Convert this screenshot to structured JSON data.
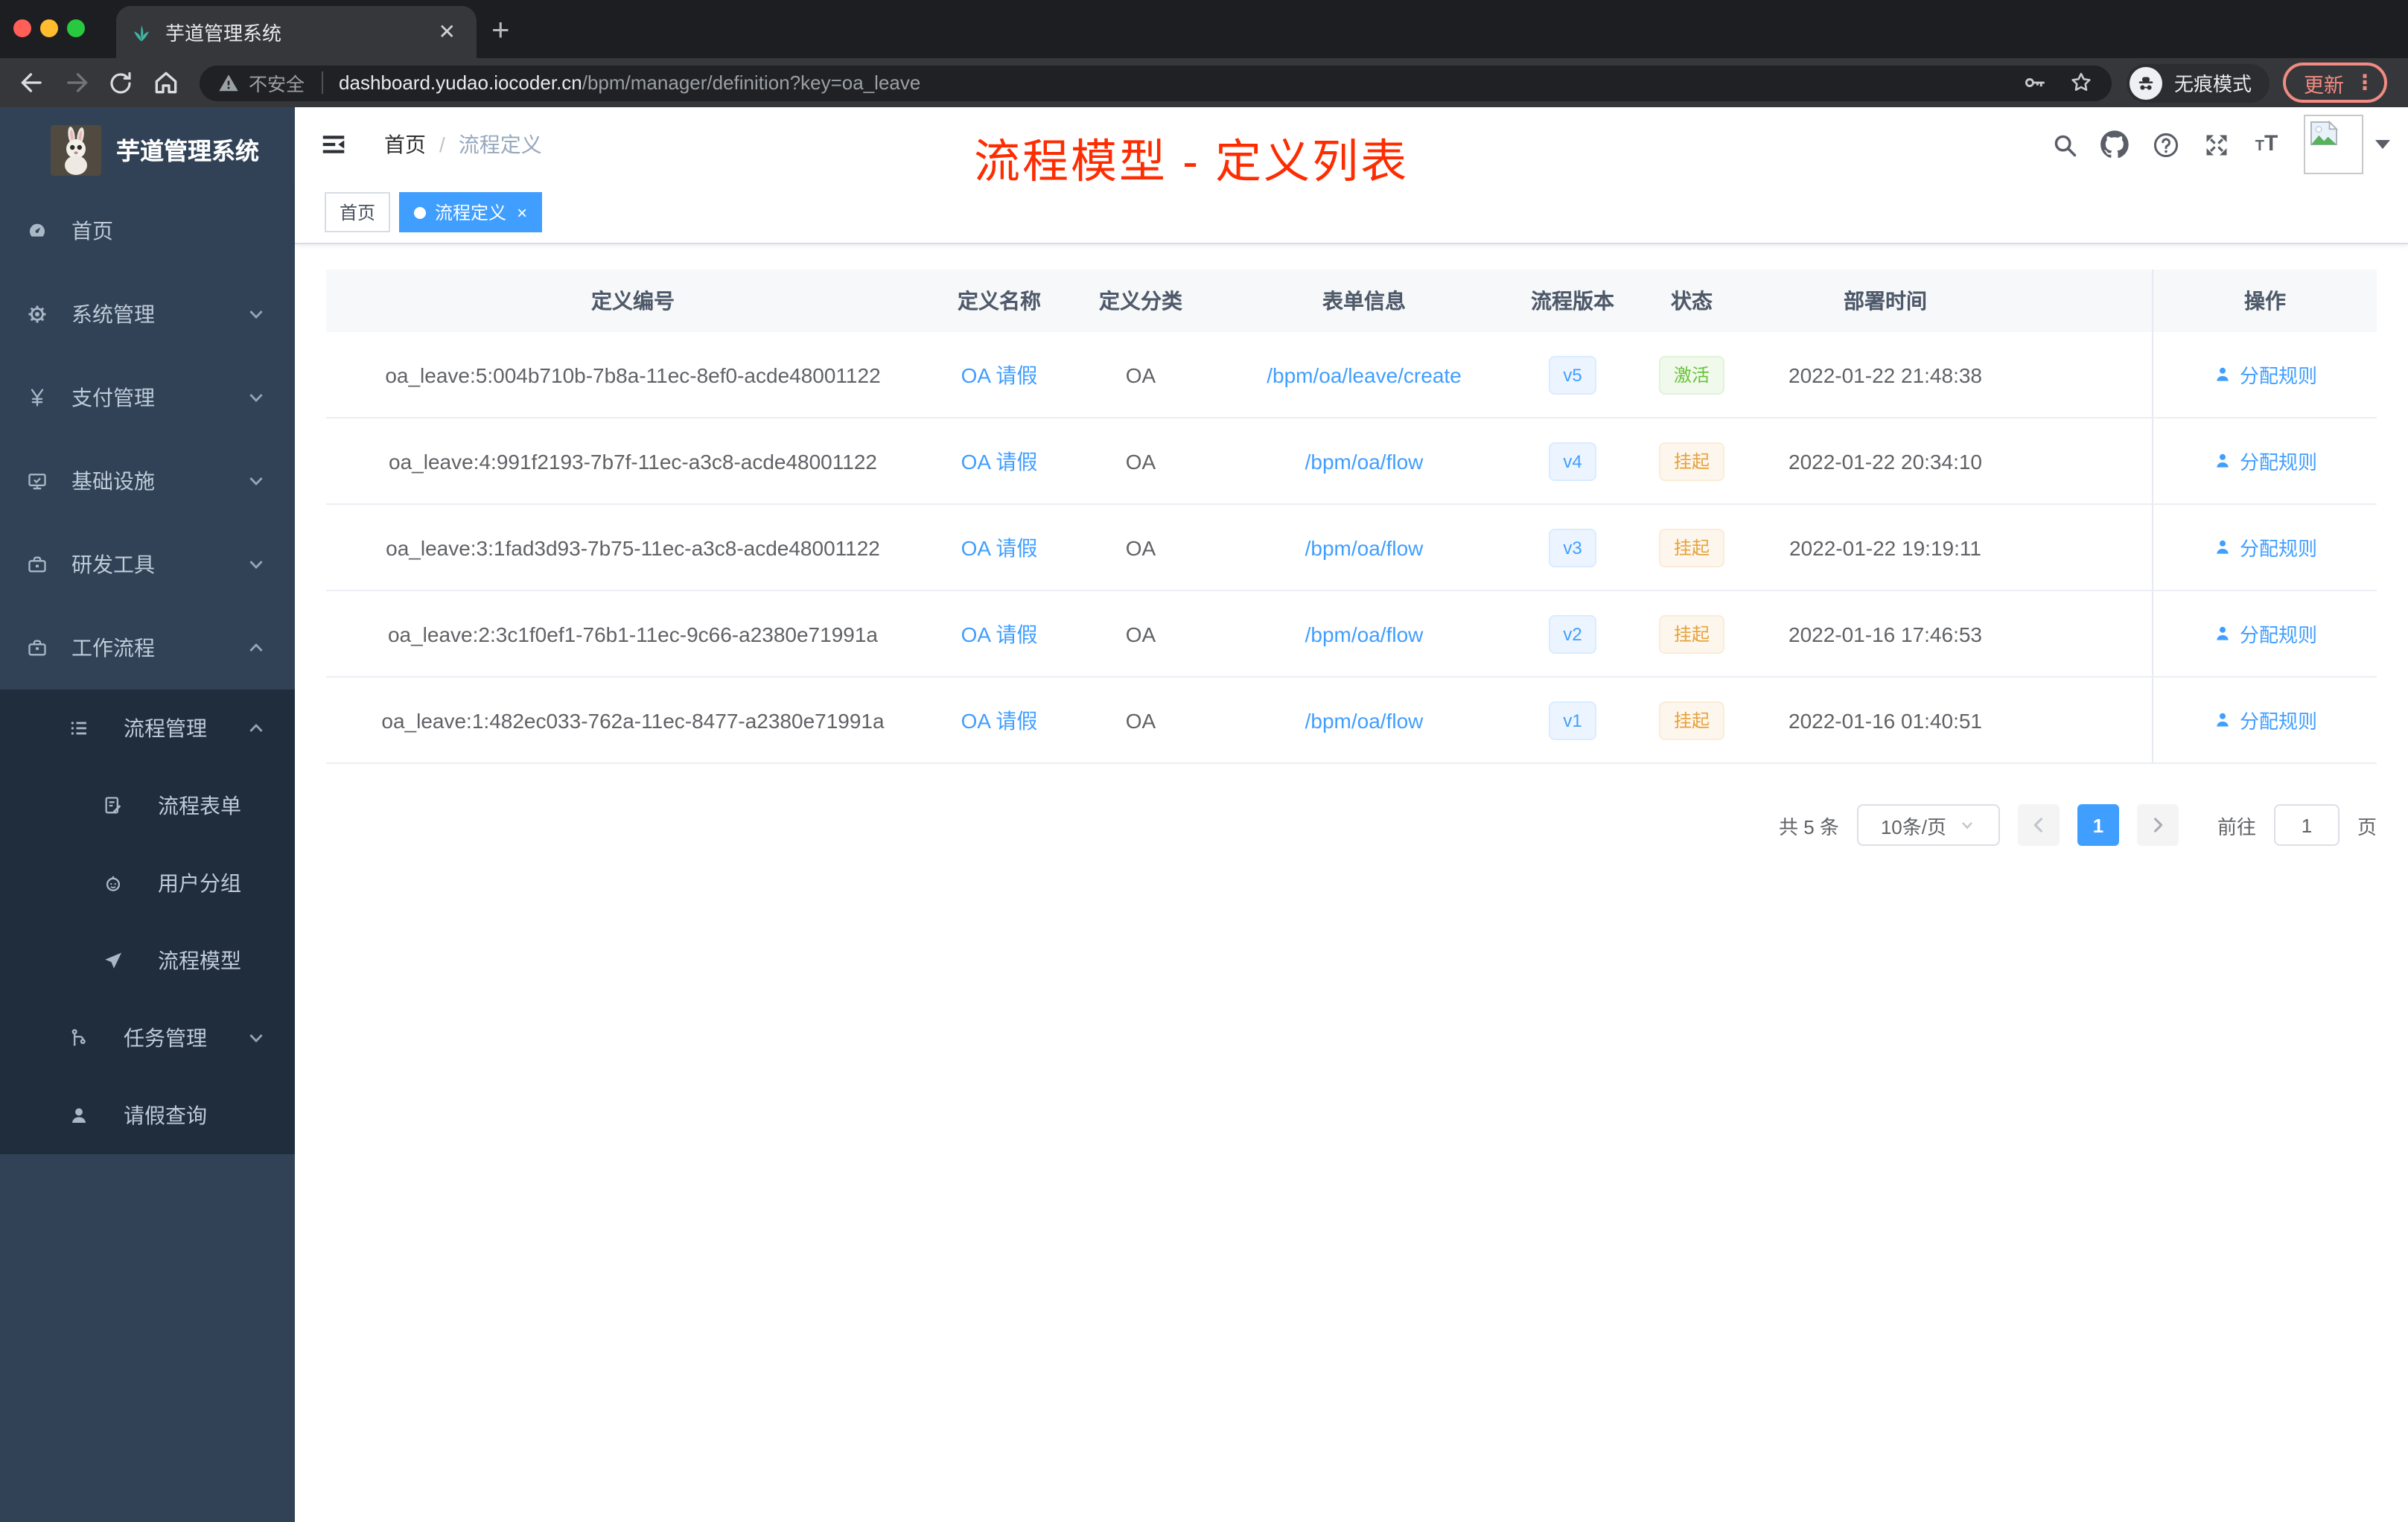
{
  "browser": {
    "tab_title": "芋道管理系统",
    "tab_close": "✕",
    "new_tab": "+",
    "security_label": "不安全",
    "url_host": "dashboard.yudao.iocoder.cn",
    "url_path": "/bpm/manager/definition?key=oa_leave",
    "incognito_label": "无痕模式",
    "update_label": "更新",
    "menu_dots": "⋮"
  },
  "sidebar": {
    "logo_title": "芋道管理系统",
    "items": [
      {
        "label": "首页",
        "icon": "dashboard-icon",
        "level": 1,
        "dark": false,
        "chevron": ""
      },
      {
        "label": "系统管理",
        "icon": "gear-icon",
        "level": 1,
        "dark": false,
        "chevron": "down"
      },
      {
        "label": "支付管理",
        "icon": "yen-icon",
        "level": 1,
        "dark": false,
        "chevron": "down"
      },
      {
        "label": "基础设施",
        "icon": "monitor-icon",
        "level": 1,
        "dark": false,
        "chevron": "down"
      },
      {
        "label": "研发工具",
        "icon": "toolbox-icon",
        "level": 1,
        "dark": false,
        "chevron": "down"
      },
      {
        "label": "工作流程",
        "icon": "briefcase-icon",
        "level": 1,
        "dark": false,
        "chevron": "up"
      },
      {
        "label": "流程管理",
        "icon": "list-icon",
        "level": 2,
        "dark": true,
        "chevron": "up"
      },
      {
        "label": "流程表单",
        "icon": "form-icon",
        "level": 3,
        "dark": true,
        "chevron": ""
      },
      {
        "label": "用户分组",
        "icon": "robot-icon",
        "level": 3,
        "dark": true,
        "chevron": ""
      },
      {
        "label": "流程模型",
        "icon": "paper-plane-icon",
        "level": 3,
        "dark": true,
        "chevron": ""
      },
      {
        "label": "任务管理",
        "icon": "flow-icon",
        "level": 2,
        "dark": true,
        "chevron": "down"
      },
      {
        "label": "请假查询",
        "icon": "user-icon",
        "level": 2,
        "dark": true,
        "chevron": ""
      }
    ]
  },
  "header": {
    "breadcrumb": [
      "首页",
      "流程定义"
    ],
    "breadcrumb_separator": "/",
    "annotation": "流程模型 - 定义列表",
    "annotation_color": "#fe2c01"
  },
  "tags": [
    {
      "label": "首页",
      "active": false
    },
    {
      "label": "流程定义",
      "active": true,
      "close": "×"
    }
  ],
  "table": {
    "columns": [
      "定义编号",
      "定义名称",
      "定义分类",
      "表单信息",
      "流程版本",
      "状态",
      "部署时间",
      "操作"
    ],
    "rows": [
      {
        "id": "oa_leave:5:004b710b-7b8a-11ec-8ef0-acde48001122",
        "name": "OA 请假",
        "category": "OA",
        "form": "/bpm/oa/leave/create",
        "version": "v5",
        "status": "激活",
        "status_type": "success",
        "deployed": "2022-01-22 21:48:38",
        "action": "分配规则"
      },
      {
        "id": "oa_leave:4:991f2193-7b7f-11ec-a3c8-acde48001122",
        "name": "OA 请假",
        "category": "OA",
        "form": "/bpm/oa/flow",
        "version": "v4",
        "status": "挂起",
        "status_type": "warning",
        "deployed": "2022-01-22 20:34:10",
        "action": "分配规则"
      },
      {
        "id": "oa_leave:3:1fad3d93-7b75-11ec-a3c8-acde48001122",
        "name": "OA 请假",
        "category": "OA",
        "form": "/bpm/oa/flow",
        "version": "v3",
        "status": "挂起",
        "status_type": "warning",
        "deployed": "2022-01-22 19:19:11",
        "action": "分配规则"
      },
      {
        "id": "oa_leave:2:3c1f0ef1-76b1-11ec-9c66-a2380e71991a",
        "name": "OA 请假",
        "category": "OA",
        "form": "/bpm/oa/flow",
        "version": "v2",
        "status": "挂起",
        "status_type": "warning",
        "deployed": "2022-01-16 17:46:53",
        "action": "分配规则"
      },
      {
        "id": "oa_leave:1:482ec033-762a-11ec-8477-a2380e71991a",
        "name": "OA 请假",
        "category": "OA",
        "form": "/bpm/oa/flow",
        "version": "v1",
        "status": "挂起",
        "status_type": "warning",
        "deployed": "2022-01-16 01:40:51",
        "action": "分配规则"
      }
    ]
  },
  "pagination": {
    "total_label": "共 5 条",
    "page_size_label": "10条/页",
    "current_page": "1",
    "prev_label": "‹",
    "next_label": "›",
    "goto_label": "前往",
    "goto_value": "1",
    "page_unit_label": "页"
  },
  "colors": {
    "accent": "#409eff",
    "success": "#67c23a",
    "warning": "#e6a23c",
    "sidebar": "#314256",
    "sidebar_submenu": "#1f2d3d",
    "annotation_red": "#fe2c01",
    "chrome_dark": "#1d1e21",
    "chrome_toolbar": "#36373b",
    "update_salmon": "#f28b82"
  }
}
